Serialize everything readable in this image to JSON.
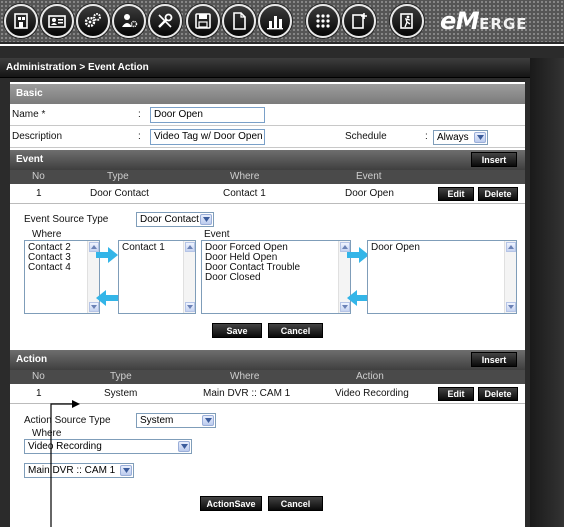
{
  "toolbar": {
    "icons": [
      "home-icon",
      "user-card-icon",
      "gears-icon",
      "user-settings-icon",
      "tools-icon",
      "save-icon",
      "report-icon",
      "chart-icon",
      "keypad-icon",
      "add-page-icon",
      "exit-icon"
    ]
  },
  "logo": {
    "initial": "eM",
    "rest": "ERGE"
  },
  "breadcrumb": "Administration > Event Action",
  "basic": {
    "header": "Basic",
    "name_label": "Name *",
    "name_value": "Door Open",
    "description_label": "Description",
    "description_value": "Video Tag w/ Door Open",
    "schedule_label": "Schedule",
    "schedule_value": "Always",
    "colon": ":"
  },
  "event": {
    "header": "Event",
    "insert_label": "Insert",
    "columns": [
      "No",
      "Type",
      "Where",
      "Event"
    ],
    "row": {
      "no": "1",
      "type": "Door Contact",
      "where": "Contact 1",
      "event": "Door Open"
    },
    "edit_label": "Edit",
    "delete_label": "Delete",
    "source_type_label": "Event Source Type",
    "source_type_value": "Door Contact",
    "where_label": "Where",
    "event_label": "Event",
    "where_available": [
      "Contact 2",
      "Contact 3",
      "Contact 4"
    ],
    "where_selected": [
      "Contact 1"
    ],
    "events_available": [
      "Door Forced Open",
      "Door Held Open",
      "Door Contact Trouble",
      "Door Closed"
    ],
    "events_selected": [
      "Door Open"
    ],
    "save_label": "Save",
    "cancel_label": "Cancel"
  },
  "action": {
    "header": "Action",
    "insert_label": "Insert",
    "columns": [
      "No",
      "Type",
      "Where",
      "Action"
    ],
    "row": {
      "no": "1",
      "type": "System",
      "where": "Main DVR :: CAM 1",
      "action": "Video Recording"
    },
    "edit_label": "Edit",
    "delete_label": "Delete",
    "source_type_label": "Action Source Type",
    "source_type_value": "System",
    "where_label": "Where",
    "action_value": "Video Recording",
    "camera_value": "Main DVR :: CAM 1",
    "save_label": "ActionSave",
    "cancel_label": "Cancel"
  },
  "colors": {
    "accent_arrow": "#33b5e8",
    "header_dark": "#3f3f3f",
    "input_border": "#7aa0c8"
  }
}
